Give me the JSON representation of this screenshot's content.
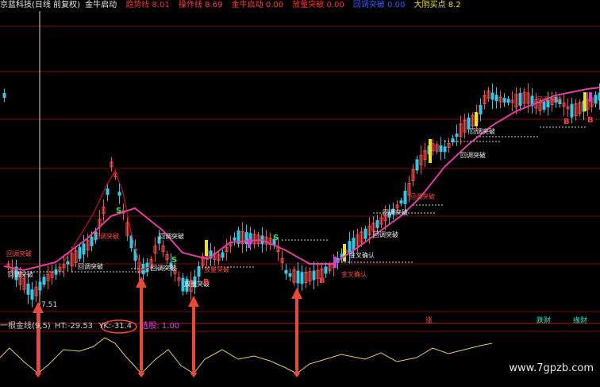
{
  "header": {
    "security_name": "京蓝科技(日线 前复权)",
    "indicator_name": "金牛启动",
    "items": [
      {
        "label": "趋势线",
        "value": "8.01",
        "color": "#e8382e"
      },
      {
        "label": "操作线",
        "value": "8.69",
        "color": "#ff4040"
      },
      {
        "label": "金牛启动",
        "value": "0.00",
        "color": "#ff4040"
      },
      {
        "label": "放量突破",
        "value": "0.00",
        "color": "#ff3030"
      },
      {
        "label": "回调突破",
        "value": "0.00",
        "color": "#3b5bff"
      },
      {
        "label": "大阴买点",
        "value": "8.2",
        "color": "#e8e030"
      }
    ]
  },
  "price_chart": {
    "low_label": "7.51",
    "signal_texts": {
      "pullback": "回调突破",
      "volume": "放量突破",
      "cross": "金叉确认"
    },
    "markers": {
      "sell": "B",
      "buy": "S",
      "up": "涨"
    }
  },
  "sub_indicator": {
    "name": "一根金线(9,5)",
    "ht_label": "HT:",
    "ht_value": "-29.53",
    "yk_label": "YK:",
    "yk_value": "-31.4",
    "signal_label": "选股:",
    "signal_value": "1.00",
    "tags": [
      "涨",
      "跌财",
      "缘財"
    ]
  },
  "watermark": "www.7gpzb.com",
  "colors": {
    "up": "#ff4f4f",
    "down": "#35c8e6",
    "trend": "#e040a0",
    "ma": "#b01818",
    "osc": "#e6c870",
    "arrow": "#e84a3a",
    "bg": "#000000"
  }
}
